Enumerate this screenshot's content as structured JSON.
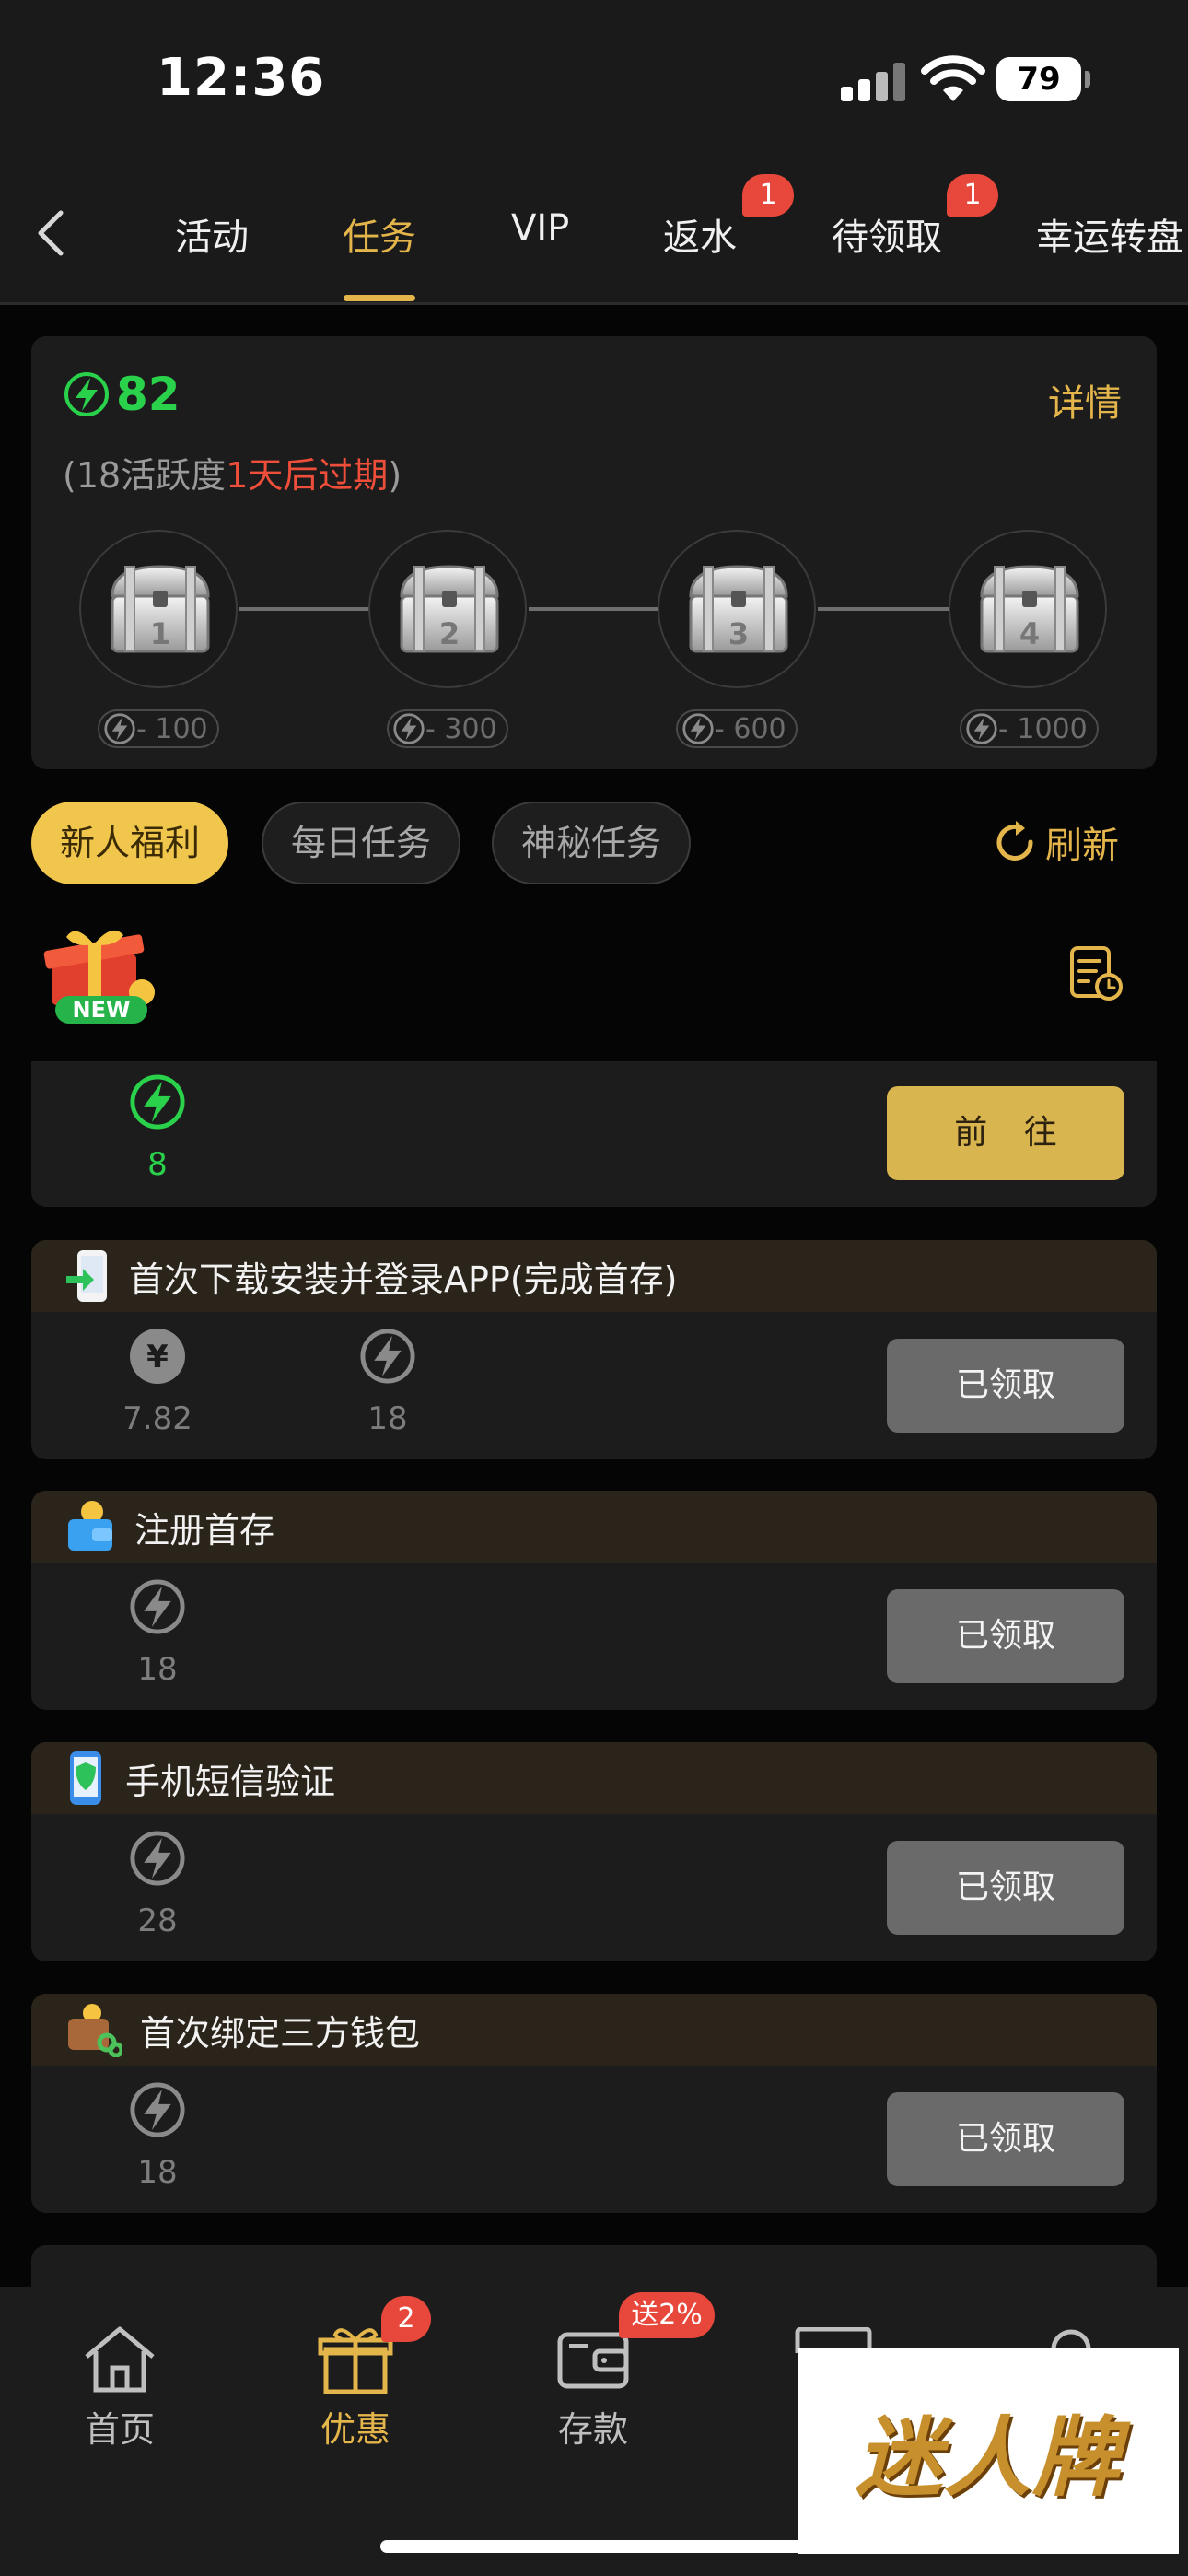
{
  "status": {
    "time": "12:36",
    "battery": "79"
  },
  "nav": {
    "tabs": [
      {
        "label": "活动"
      },
      {
        "label": "任务"
      },
      {
        "label": "VIP"
      },
      {
        "label": "返水",
        "badge": "1"
      },
      {
        "label": "待领取",
        "badge": "1"
      },
      {
        "label": "幸运转盘"
      }
    ],
    "active_tab": "任务"
  },
  "progress": {
    "points": "82",
    "detail_label": "详情",
    "sub_prefix": "(18活跃度",
    "sub_red": "1天后过期",
    "sub_suffix": ")",
    "chests": [
      {
        "num": "1",
        "req": "- 100"
      },
      {
        "num": "2",
        "req": "- 300"
      },
      {
        "num": "3",
        "req": "- 600"
      },
      {
        "num": "4",
        "req": "- 1000"
      }
    ]
  },
  "filters": [
    "新人福利",
    "每日任务",
    "神秘任务"
  ],
  "refresh_label": "刷新",
  "new_badge": "NEW",
  "tasks": [
    {
      "title": "",
      "rewards": [
        {
          "icon": "bolt-green-icon",
          "value": "8"
        }
      ],
      "button": "前 往"
    },
    {
      "title": "首次下载安装并登录APP(完成首存)",
      "icon": "phone-download-icon",
      "rewards": [
        {
          "icon": "yen-coin-icon",
          "value": "7.82"
        },
        {
          "icon": "bolt-gray-icon",
          "value": "18"
        }
      ],
      "button": "已领取"
    },
    {
      "title": "注册首存",
      "icon": "wallet-coin-icon",
      "rewards": [
        {
          "icon": "bolt-gray-icon",
          "value": "18"
        }
      ],
      "button": "已领取"
    },
    {
      "title": "手机短信验证",
      "icon": "phone-shield-icon",
      "rewards": [
        {
          "icon": "bolt-gray-icon",
          "value": "28"
        }
      ],
      "button": "已领取"
    },
    {
      "title": "首次绑定三方钱包",
      "icon": "wallet-link-icon",
      "rewards": [
        {
          "icon": "bolt-gray-icon",
          "value": "18"
        }
      ],
      "button": "已领取"
    }
  ],
  "bottom_nav": [
    {
      "label": "首页",
      "icon": "home-icon"
    },
    {
      "label": "优惠",
      "icon": "gift-icon",
      "badge": "2"
    },
    {
      "label": "存款",
      "icon": "wallet-icon",
      "badge": "送2%"
    }
  ],
  "watermark": "迷人牌",
  "colors": {
    "accent": "#e3b54a",
    "green": "#2ad14a",
    "badge": "#e8483c"
  }
}
